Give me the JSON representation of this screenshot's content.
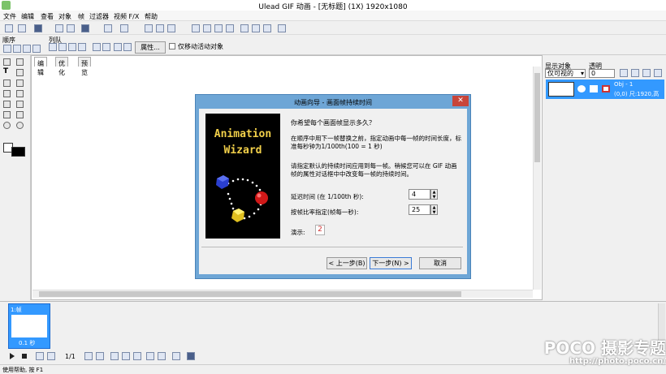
{
  "window": {
    "title": "Ulead GIF 动画 - [无标题] (1X) 1920x1080"
  },
  "menu": [
    "文件",
    "编辑",
    "查看",
    "对象",
    "帧",
    "过滤器",
    "视频 F/X",
    "帮助"
  ],
  "toolbar2": {
    "order_label": "顺序",
    "align_label": "列队",
    "properties_button": "属性...",
    "move_active_only": "仅移动活动对象"
  },
  "tabs": [
    "编辑",
    "优化",
    "预览"
  ],
  "right_panel": {
    "show_objects_label": "显示对象",
    "transparency_label": "透明",
    "show_mode": "仅可视的",
    "transparency_value": "0",
    "object_name": "Obj - 1",
    "object_info": "(0,0) 尺:1920,高"
  },
  "frame_panel": {
    "frame_label": "1:帧",
    "frame_delay": "0.1 秒",
    "page_count": "1/1"
  },
  "statusbar": {
    "text": "使用帮助, 按 F1"
  },
  "dialog": {
    "title": "动画向导 - 画面帧持续时间",
    "close": "✕",
    "wizard_line1": "Animation",
    "wizard_line2": "Wizard",
    "question": "你希望每个画面帧显示多久？",
    "para1": "在顺序中用下一帧替换之前，指定动画中每一帧的时间长度，标准每秒钟为1/100th(100 = 1 秒)",
    "para2": "请指定默认的持续时间应用到每一帧。稍候您可以在 GIF 动画帧的属性对话框中中改变每一帧的持续时间。",
    "delay_label": "延迟时间 (在 1/100th 秒):",
    "delay_value": "4",
    "fps_label": "按帧比率指定(帧每一秒):",
    "fps_value": "25",
    "demo_label": "演示:",
    "demo_value": "2",
    "back_button": "< 上一步(B)",
    "next_button": "下一步(N) >",
    "cancel_button": "取消"
  },
  "watermark": {
    "logo": "POCO 摄影专题",
    "url": "http://photo.poco.cn/"
  }
}
